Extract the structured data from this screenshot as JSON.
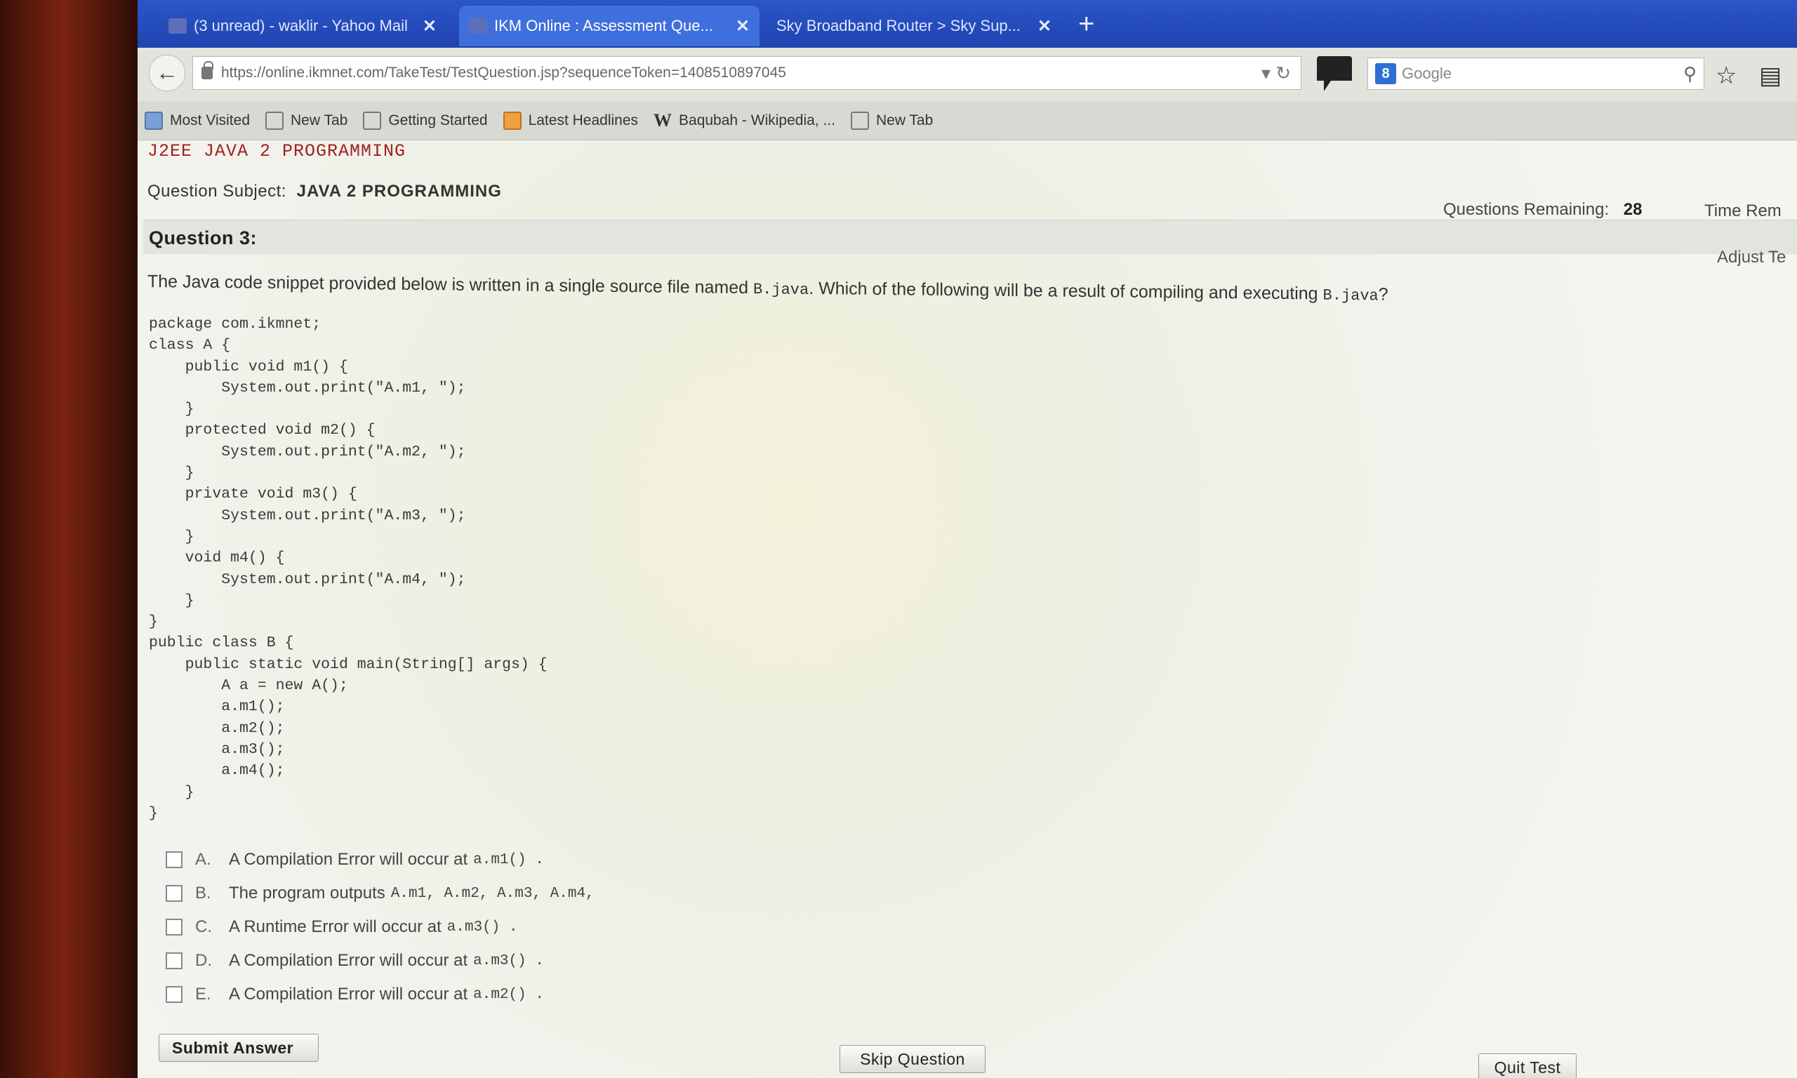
{
  "tabs": [
    {
      "title": "(3 unread) - waklir - Yahoo Mail",
      "close": "✕",
      "active": false
    },
    {
      "title": "IKM Online : Assessment Que...",
      "close": "✕",
      "active": true
    },
    {
      "title": "Sky Broadband Router > Sky Sup...",
      "close": "✕",
      "active": false
    }
  ],
  "new_tab": "+",
  "nav": {
    "url": "https://online.ikmnet.com/TakeTest/TestQuestion.jsp?sequenceToken=1408510897045",
    "search_engine": "Google"
  },
  "bookmarks": [
    "Most Visited",
    "New Tab",
    "Getting Started",
    "Latest Headlines",
    "Baqubah - Wikipedia, ...",
    "New Tab"
  ],
  "page": {
    "header": "J2EE JAVA 2 PROGRAMMING",
    "subject_label": "Question Subject:",
    "subject_value": "JAVA 2 PROGRAMMING",
    "remaining_label": "Questions Remaining:",
    "remaining_value": "28",
    "time_label": "Time Rem",
    "adjust_label": "Adjust Te",
    "question_title": "Question 3:",
    "question_text_1": "The Java code snippet provided below is written in a single source file named ",
    "question_file_1": "B.java",
    "question_text_2": ". Which of the following will be a result of compiling and executing ",
    "question_file_2": "B.java",
    "question_text_3": "?",
    "code": "package com.ikmnet;\nclass A {\n    public void m1() {\n        System.out.print(\"A.m1, \");\n    }\n    protected void m2() {\n        System.out.print(\"A.m2, \");\n    }\n    private void m3() {\n        System.out.print(\"A.m3, \");\n    }\n    void m4() {\n        System.out.print(\"A.m4, \");\n    }\n}\npublic class B {\n    public static void main(String[] args) {\n        A a = new A();\n        a.m1();\n        a.m2();\n        a.m3();\n        a.m4();\n    }\n}",
    "options": [
      {
        "letter": "A.",
        "text": "A Compilation Error will occur at",
        "code": "a.m1() ."
      },
      {
        "letter": "B.",
        "text": "The program outputs",
        "code": "A.m1, A.m2, A.m3, A.m4,"
      },
      {
        "letter": "C.",
        "text": "A Runtime Error will occur at",
        "code": "a.m3() ."
      },
      {
        "letter": "D.",
        "text": "A Compilation Error will occur at",
        "code": "a.m3() ."
      },
      {
        "letter": "E.",
        "text": "A Compilation Error will occur at",
        "code": "a.m2() ."
      }
    ],
    "submit_label": "Submit Answer",
    "skip_label": "Skip Question",
    "quit_label": "Quit Test"
  }
}
